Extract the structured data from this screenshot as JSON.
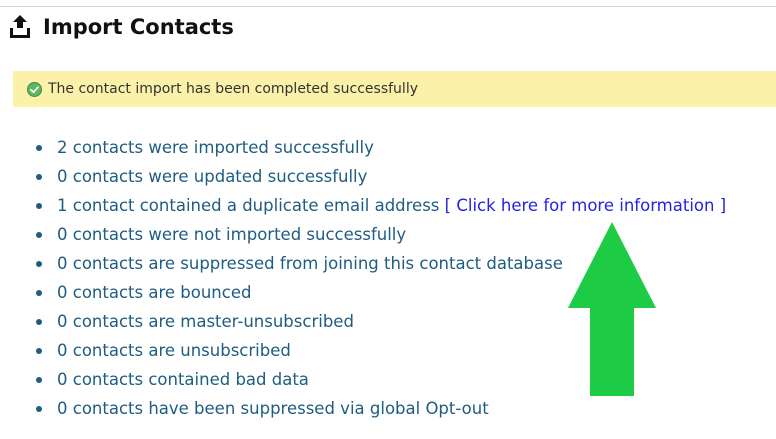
{
  "header": {
    "title": "Import Contacts",
    "icon": "upload-tray-icon"
  },
  "alert": {
    "icon": "success-check-icon",
    "message": "The contact import has been completed successfully",
    "background_color": "#fbf1a8"
  },
  "results": [
    {
      "text": "2 contacts were imported successfully"
    },
    {
      "text": "0 contacts were updated successfully"
    },
    {
      "text": "1 contact contained a duplicate email address",
      "link": "[ Click here for more information ]"
    },
    {
      "text": "0 contacts were not imported successfully"
    },
    {
      "text": "0 contacts are suppressed from joining this contact database"
    },
    {
      "text": "0 contacts are bounced"
    },
    {
      "text": "0 contacts are master-unsubscribed"
    },
    {
      "text": "0 contacts are unsubscribed"
    },
    {
      "text": "0 contacts contained bad data"
    },
    {
      "text": "0 contacts have been suppressed via global Opt-out"
    }
  ],
  "annotation": {
    "icon": "green-up-arrow-icon",
    "color": "#1ecb45"
  },
  "colors": {
    "text_link": "#1f5c82",
    "more_info_link": "#2424e0"
  }
}
